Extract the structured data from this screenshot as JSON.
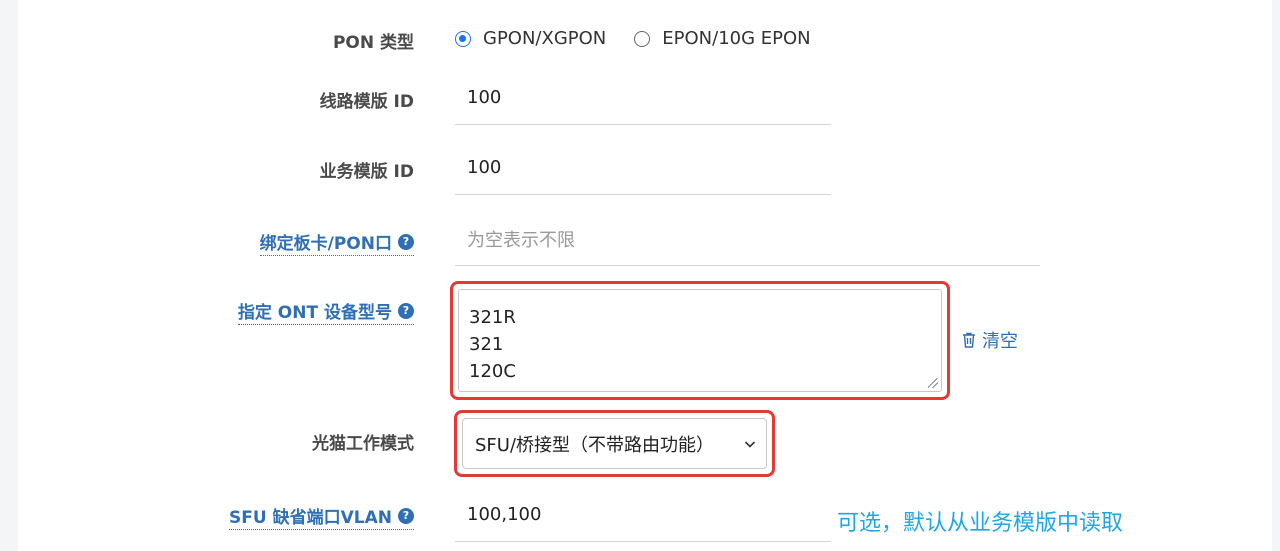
{
  "form": {
    "pon_type": {
      "label": "PON 类型",
      "options": [
        {
          "label": "GPON/XGPON",
          "checked": true
        },
        {
          "label": "EPON/10G EPON",
          "checked": false
        }
      ]
    },
    "line_profile": {
      "label": "线路模版 ID",
      "value": "100"
    },
    "service_profile": {
      "label": "业务模版 ID",
      "value": "100"
    },
    "bind_board": {
      "label": "绑定板卡/PON口",
      "placeholder": "为空表示不限",
      "help": "?"
    },
    "ont_models": {
      "label": "指定 ONT 设备型号",
      "help": "?",
      "lines": [
        "321R",
        "321",
        "120C"
      ],
      "clear_label": "清空"
    },
    "ont_mode": {
      "label": "光猫工作模式",
      "selected": "SFU/桥接型（不带路由功能）"
    },
    "sfu_vlan": {
      "label": "SFU 缺省端口VLAN",
      "help": "?",
      "value": "100,100",
      "note": "可选，默认从业务模版中读取"
    }
  },
  "colors": {
    "accent": "#1a73e8",
    "link": "#2f6fb3",
    "highlight": "#e53935",
    "note": "#1ea7e6"
  }
}
